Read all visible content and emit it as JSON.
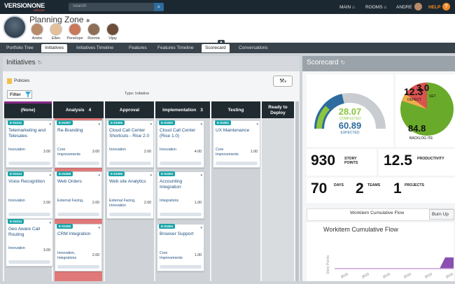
{
  "brand": {
    "name": "VERSIONONE",
    "sub": "ultimate"
  },
  "search": {
    "placeholder": "search"
  },
  "topnav": {
    "main": "MAIN",
    "rooms": "ROOMS",
    "user": "ANDRE",
    "help": "HELP",
    "help_icon": "?"
  },
  "room": {
    "title": "Planning Zone",
    "members": [
      {
        "name": "Andre",
        "color": "#b88a6a"
      },
      {
        "name": "Ellen",
        "color": "#e3c09a"
      },
      {
        "name": "Penelope",
        "color": "#c9785a"
      },
      {
        "name": "Ronnie",
        "color": "#8d6e57"
      },
      {
        "name": "Vijay",
        "color": "#6e4e3a"
      }
    ]
  },
  "tabs": [
    "Portfolio Tree",
    "Initiatives",
    "Initiatives Timeline",
    "Features",
    "Features Timeline",
    "Scorecard",
    "Conversations"
  ],
  "initiatives": {
    "title": "Initiatives",
    "policies": "Policies",
    "filter": "Filter",
    "type_label": "Type: Initiative",
    "wrench": "⚒"
  },
  "columns": [
    {
      "title": "(None)"
    },
    {
      "title": "Analysis",
      "count": "4"
    },
    {
      "title": "Approval"
    },
    {
      "title": "Implementation",
      "count": "3"
    },
    {
      "title": "Testing"
    },
    {
      "title": "Ready to Deploy"
    }
  ],
  "cards": [
    {
      "id": "E-01012",
      "title": "Telemarketing and Telesales",
      "theme": "Innovation",
      "est": "3.00"
    },
    {
      "id": "E-01013",
      "title": "Voice Recognition",
      "theme": "Innovation",
      "est": "2.00"
    },
    {
      "id": "E-01014",
      "title": "Geo Aware Call Routing",
      "theme": "Innovation",
      "est": "3.00"
    },
    {
      "id": "E-01007",
      "title": "Re-Branding",
      "theme": "Core Improvements",
      "est": "3.00"
    },
    {
      "id": "E-01008",
      "title": "Web Orders",
      "theme": "External Facing,",
      "est": "2.00"
    },
    {
      "id": "E-01009",
      "title": "CRM Integration",
      "theme": "Innovation, Integrations",
      "est": "2.00"
    },
    {
      "id": "E-01005",
      "title": "Cloud Call Center Shortcuts - Rise 2.0",
      "theme": "Innovation",
      "est": "2.00"
    },
    {
      "id": "E-01006",
      "title": "Web site Analytics",
      "theme": "External Facing, Innovation",
      "est": "2.00"
    },
    {
      "id": "E-01002",
      "title": "Cloud Call Center (Rise 1.0)",
      "theme": "Innovation",
      "est": "4.00"
    },
    {
      "id": "E-01003",
      "title": "Accounting Integration",
      "theme": "Integrations",
      "est": "1.00"
    },
    {
      "id": "E-01004",
      "title": "Browser Support",
      "theme": "Core Improvements",
      "est": "1.00"
    },
    {
      "id": "E-01001",
      "title": "UX Maintenance",
      "theme": "Core Improvements",
      "est": "1.00"
    }
  ],
  "scorecard": {
    "title": "Scorecard",
    "gauge": {
      "completed": "28.07",
      "completed_label": "COMPLETED",
      "expected": "60.89",
      "expected_label": "EXPECTED"
    },
    "pie": {
      "top_value": "12.3",
      "top_pct": "3.0",
      "label_a": "DEFECT",
      "label_b": "SET",
      "bottom_value": "84.8",
      "bottom_pct": "%",
      "bottom_label": "BACKLOG ITE"
    },
    "story_points": "930",
    "story_points_label": "STORY POINTS",
    "productivity": "12.5",
    "productivity_label": "PRODUCTIVITY",
    "days": "70",
    "days_label": "DAYS",
    "teams": "2",
    "teams_label": "TEAMS",
    "projects": "1",
    "projects_label": "PROJECTS",
    "cf_tab": "Workitem Cumulative Flow",
    "burnup": "Burn Up",
    "cf_title": "Workitem Cumulative Flow",
    "cf_ylabel": "Story Points",
    "cf_xtick": "2015"
  },
  "colors": {
    "teal": "#18a3a7",
    "red_col": "#e07a7a",
    "purple": "#8a2b8a",
    "dark": "#202a31"
  }
}
